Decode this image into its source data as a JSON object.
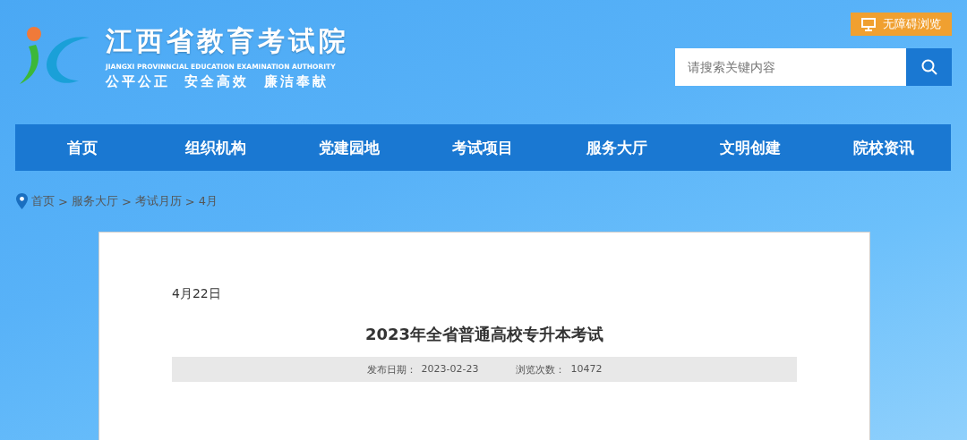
{
  "header": {
    "title": "江西省教育考试院",
    "subtitle": "JIANGXI PROVINNCIAL EDUCATION EXAMINATION AUTHORITY",
    "slogan": "公平公正  安全高效  廉洁奉献",
    "accessibility_button": "无障碍浏览",
    "search": {
      "placeholder": "请搜索关键内容"
    }
  },
  "nav": {
    "items": [
      {
        "label": "首页"
      },
      {
        "label": "组织机构"
      },
      {
        "label": "党建园地"
      },
      {
        "label": "考试项目"
      },
      {
        "label": "服务大厅"
      },
      {
        "label": "文明创建"
      },
      {
        "label": "院校资讯"
      }
    ]
  },
  "breadcrumb": [
    "首页",
    "服务大厅",
    "考试月历",
    "4月"
  ],
  "breadcrumb_separator": ">",
  "article": {
    "date_heading": "4月22日",
    "title": "2023年全省普通高校专升本考试",
    "meta": [
      {
        "label": "发布日期：",
        "value": "2023-02-23"
      },
      {
        "label": "浏览次数：",
        "value": "10472"
      }
    ]
  }
}
